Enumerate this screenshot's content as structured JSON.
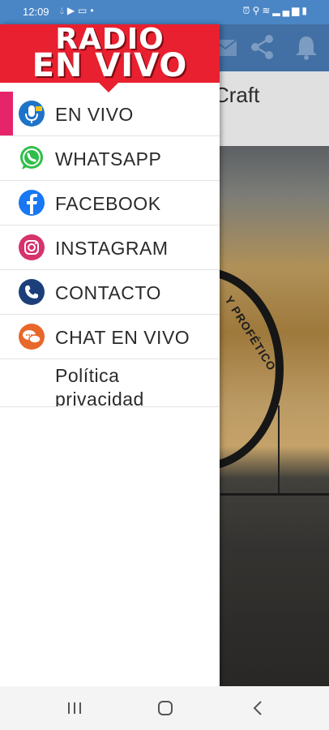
{
  "status_bar": {
    "time": "12:09",
    "left_icons": [
      "drop-icon",
      "play-icon",
      "cast-icon",
      "dot-icon"
    ],
    "right_icons": [
      "alarm-icon",
      "location-icon",
      "wifi-icon",
      "signal-icon",
      "battery-icon"
    ]
  },
  "background_app": {
    "title_fragment": "Craft",
    "logo_text": "Y PROFÉTICO",
    "toolbar_icons": [
      "mail-icon",
      "share-icon",
      "bell-icon"
    ],
    "colors": {
      "toolbar": "#4c7fbb"
    }
  },
  "drawer": {
    "brand": {
      "line1": "RADIO",
      "line2": "EN VIVO",
      "color": "#e8202f"
    },
    "items": [
      {
        "label": "EN VIVO",
        "icon": "microphone-icon",
        "active": true
      },
      {
        "label": "WHATSAPP",
        "icon": "whatsapp-icon"
      },
      {
        "label": "FACEBOOK",
        "icon": "facebook-icon"
      },
      {
        "label": "INSTAGRAM",
        "icon": "instagram-icon"
      },
      {
        "label": "CONTACTO",
        "icon": "phone-icon"
      },
      {
        "label": "CHAT EN VIVO",
        "icon": "chat-icon"
      },
      {
        "label": "Política privacidad",
        "icon": ""
      }
    ],
    "active_color": "#e6246a"
  },
  "nav_bar": {
    "buttons": [
      "recent-apps-button",
      "home-button",
      "back-button"
    ]
  }
}
